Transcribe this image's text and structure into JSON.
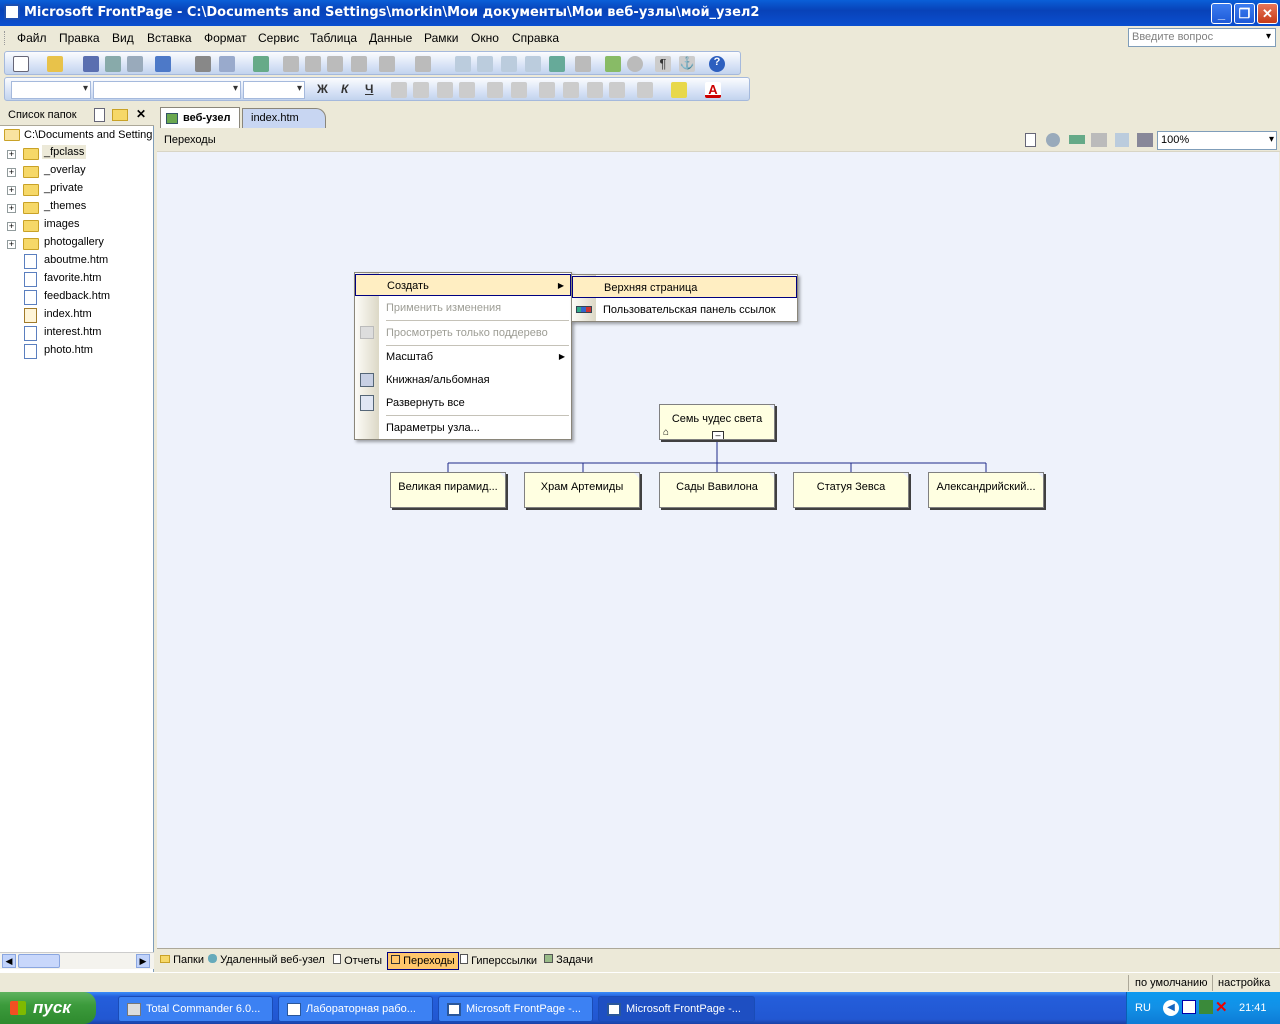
{
  "window": {
    "title": "Microsoft FrontPage - C:\\Documents and Settings\\morkin\\Мои документы\\Мои веб-узлы\\мой_узел2"
  },
  "menubar": {
    "items": [
      "Файл",
      "Правка",
      "Вид",
      "Вставка",
      "Формат",
      "Сервис",
      "Таблица",
      "Данные",
      "Рамки",
      "Окно",
      "Справка"
    ],
    "help_placeholder": "Введите вопрос"
  },
  "toolbar_format": {
    "bold": "Ж",
    "italic": "К",
    "underline": "Ч"
  },
  "folder_list": {
    "title": "Список папок",
    "root": "C:\\Documents and Setting",
    "items": [
      {
        "name": "_fpclass",
        "type": "folder",
        "expandable": true,
        "selected": true
      },
      {
        "name": "_overlay",
        "type": "folder",
        "expandable": true
      },
      {
        "name": "_private",
        "type": "folder",
        "expandable": true
      },
      {
        "name": "_themes",
        "type": "folder",
        "expandable": true
      },
      {
        "name": "images",
        "type": "folder",
        "expandable": true
      },
      {
        "name": "photogallery",
        "type": "folder",
        "expandable": true
      },
      {
        "name": "aboutme.htm",
        "type": "file"
      },
      {
        "name": "favorite.htm",
        "type": "file"
      },
      {
        "name": "feedback.htm",
        "type": "file"
      },
      {
        "name": "index.htm",
        "type": "file"
      },
      {
        "name": "interest.htm",
        "type": "file"
      },
      {
        "name": "photo.htm",
        "type": "file"
      }
    ]
  },
  "tabs": [
    {
      "label": "веб-узел",
      "active": true
    },
    {
      "label": "index.htm",
      "active": false
    }
  ],
  "view_header": {
    "title": "Переходы",
    "zoom": "100%"
  },
  "navigation": {
    "root": "Семь чудес света",
    "children": [
      "Великая пирамид...",
      "Храм Артемиды",
      "Сады Вавилона",
      "Статуя Зевса",
      "Александрийский..."
    ]
  },
  "context_menu": {
    "items": [
      {
        "label": "Создать",
        "submenu": true,
        "highlighted": true
      },
      {
        "label": "Применить изменения",
        "disabled": true
      },
      {
        "label": "Просмотреть только поддерево",
        "disabled": true
      },
      {
        "label": "Масштаб",
        "submenu": true
      },
      {
        "label": "Книжная/альбомная"
      },
      {
        "label": "Развернуть все"
      },
      {
        "label": "Параметры узла..."
      }
    ],
    "submenu": [
      {
        "label": "Верхняя страница",
        "highlighted": true
      },
      {
        "label": "Пользовательская панель ссылок"
      }
    ]
  },
  "views": [
    {
      "label": "Папки"
    },
    {
      "label": "Удаленный веб-узел"
    },
    {
      "label": "Отчеты"
    },
    {
      "label": "Переходы",
      "active": true
    },
    {
      "label": "Гиперссылки"
    },
    {
      "label": "Задачи"
    }
  ],
  "statusbar": {
    "default_label": "по умолчанию",
    "settings_label": "настройка"
  },
  "taskbar": {
    "start": "пуск",
    "tasks": [
      "Total Commander 6.0...",
      "Лабораторная рабо...",
      "Microsoft FrontPage -...",
      "Microsoft FrontPage -..."
    ],
    "lang": "RU",
    "time": "21:41"
  }
}
